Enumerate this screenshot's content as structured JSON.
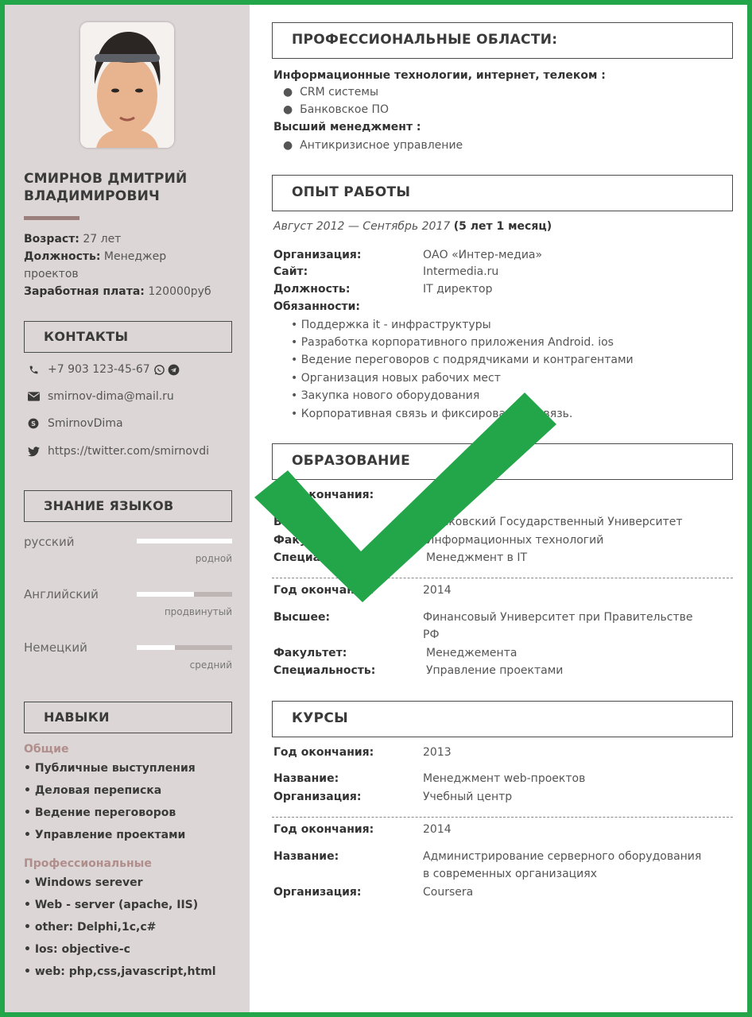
{
  "profile": {
    "name_line1": "СМИРНОВ ДМИТРИЙ",
    "name_line2": "ВЛАДИМИРОВИЧ",
    "age_label": "Возраст:",
    "age_value": "27 лет",
    "position_label": "Должность:",
    "position_value1": "Менеджер",
    "position_value2": "проектов",
    "salary_label": "Заработная плата:",
    "salary_value": "120000руб"
  },
  "contacts": {
    "title": "КОНТАКТЫ",
    "phone": "+7 903 123-45-67",
    "email": "smirnov-dima@mail.ru",
    "skype": "SmirnovDima",
    "twitter": "https://twitter.com/smirnovdi"
  },
  "languages": {
    "title": "ЗНАНИЕ ЯЗЫКОВ",
    "items": [
      {
        "name": "русский",
        "level": "родной",
        "fill": 1.0
      },
      {
        "name": "Английский",
        "level": "продвинутый",
        "fill": 0.6
      },
      {
        "name": "Немецкий",
        "level": "средний",
        "fill": 0.4
      }
    ]
  },
  "skills": {
    "title": "НАВЫКИ",
    "general_title": "Общие",
    "general": [
      "• Публичные выступления",
      "• Деловая переписка",
      "• Ведение переговоров",
      "• Управление проектами"
    ],
    "pro_title": "Профессиональные",
    "pro": [
      "• Windows serever",
      "• Web - server (apache, IIS)",
      "• other: Delphi,1c,c#",
      "• Ios: objective-c",
      "• web: php,css,javascript,html"
    ]
  },
  "areas": {
    "title": "ПРОФЕССИОНАЛЬНЫЕ ОБЛАСТИ:",
    "group1": "Информационные технологии, интернет, телеком :",
    "group1_items": [
      "CRM системы",
      "Банковское ПО"
    ],
    "group2": "Высший менеджмент :",
    "group2_items": [
      "Антикризисное управление"
    ]
  },
  "experience": {
    "title": "ОПЫТ РАБОТЫ",
    "period": "Август 2012 — Сентябрь 2017",
    "duration": "(5 лет 1 месяц)",
    "org_label": "Организация:",
    "org_value": "ОАО «Интер-медиа»",
    "site_label": "Сайт:",
    "site_value": "Intermedia.ru",
    "pos_label": "Должность:",
    "pos_value": "IT директор",
    "duties_label": "Обязанности:",
    "duties": [
      "• Поддержка it - инфраструктуры",
      "• Разработка корпоративного приложения Android. ios",
      "• Ведение переговоров с подрядчиками и контрагентами",
      "• Организация новых рабочих мест",
      "• Закупка нового оборудования",
      "• Корпоративная связь и фиксированная связь."
    ]
  },
  "education": {
    "title": "ОБРАЗОВАНИЕ",
    "e1_year_label": "Год окончания:",
    "e1_higher_label": "Высшее:",
    "e1_higher_value": "Московский Государственный Университет",
    "e1_faculty_label": "Факультет:",
    "e1_faculty_value": "Информационных технологий",
    "e1_spec_label": "Специальность:",
    "e1_spec_value": "Менеджмент в IT",
    "e2_year_label": "Год окончания:",
    "e2_year_value": "2014",
    "e2_higher_label": "Высшее:",
    "e2_higher_value1": "Финансовый Университет при Правительстве",
    "e2_higher_value2": "РФ",
    "e2_faculty_label": "Факультет:",
    "e2_faculty_value": "Менеджемента",
    "e2_spec_label": "Специальность:",
    "e2_spec_value": "Управление проектами"
  },
  "courses": {
    "title": "КУРСЫ",
    "c1_year_label": "Год окончания:",
    "c1_year_value": "2013",
    "c1_name_label": "Название:",
    "c1_name_value": "Менеджмент web-проектов",
    "c1_org_label": "Организация:",
    "c1_org_value": "Учебный центр",
    "c2_year_label": "Год окончания:",
    "c2_year_value": "2014",
    "c2_name_label": "Название:",
    "c2_name_value1": "Администрирование серверного оборудования",
    "c2_name_value2": "в современных организациях",
    "c2_org_label": "Организация:",
    "c2_org_value": "Coursera"
  },
  "colors": {
    "frame": "#22a649",
    "sidebar": "#ddd6d6",
    "accent": "#b08e8c",
    "check": "#22a649"
  },
  "icons": [
    "phone-icon",
    "whatsapp-icon",
    "telegram-icon",
    "mail-icon",
    "skype-icon",
    "twitter-icon",
    "checkmark-icon"
  ]
}
